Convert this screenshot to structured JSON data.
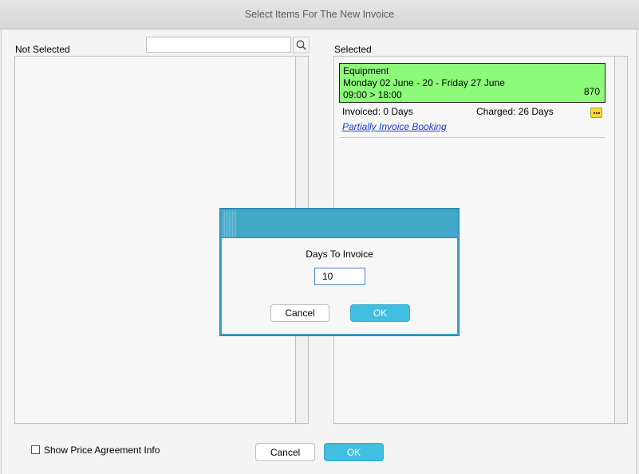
{
  "window": {
    "title": "Select Items For The New Invoice"
  },
  "not_selected": {
    "label": "Not Selected",
    "search_placeholder": ""
  },
  "selected": {
    "label": "Selected",
    "item": {
      "name": "Equipment",
      "dates": "Monday 02 June - 20 - Friday 27 June",
      "times": "09:00 > 18:00",
      "amount": "870",
      "invoiced": "Invoiced: 0 Days",
      "charged": "Charged: 26 Days",
      "partial_link": "Partially Invoice Booking"
    }
  },
  "dialog": {
    "title": "Days To Invoice",
    "value": "10",
    "cancel_label": "Cancel",
    "ok_label": "OK"
  },
  "footer": {
    "checkbox_label": "Show Price Agreement Info",
    "cancel_label": "Cancel",
    "ok_label": "OK"
  },
  "colors": {
    "accent": "#41bfe0",
    "dialog_header": "#41a8c8",
    "item_background": "#8dfb7a",
    "link": "#1a3ccf"
  }
}
